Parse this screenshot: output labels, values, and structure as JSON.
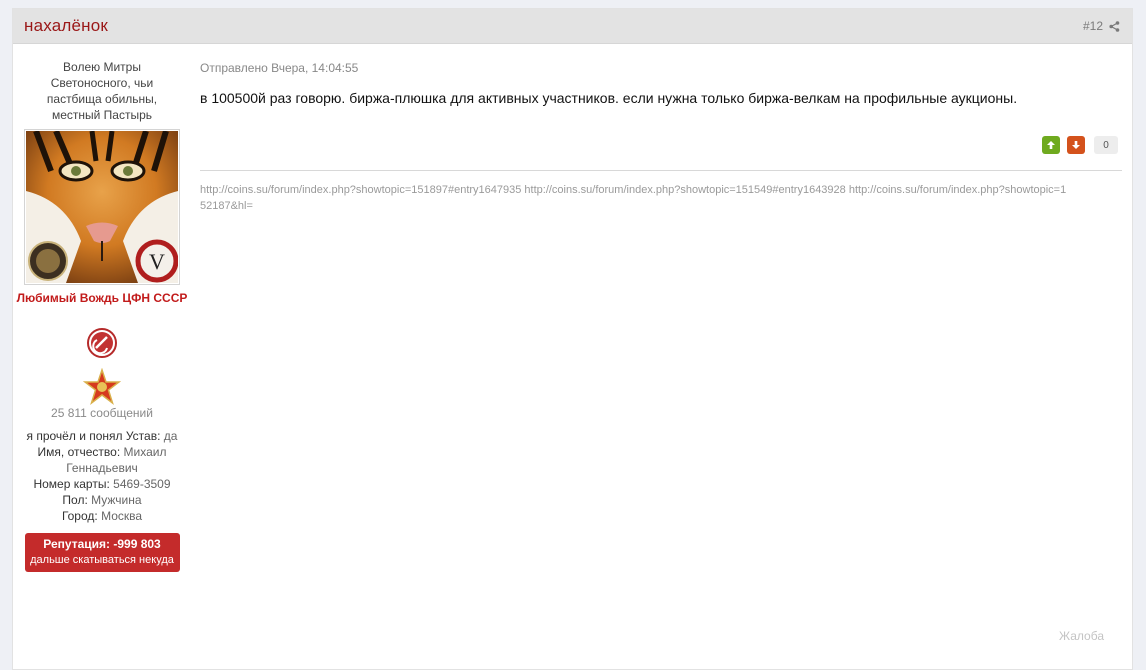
{
  "post": {
    "author": "нахалёнок",
    "number": "#12",
    "posted_label": "Отправлено Вчера, 14:04:55",
    "text": "в 100500й раз говорю. биржа-плюшка для активных участников. если нужна только биржа-велкам на профильные аукционы.",
    "rating": {
      "up_icon": "arrow-up-icon",
      "down_icon": "arrow-down-icon",
      "count": "0"
    },
    "signature": "http://coins.su/forum/index.php?showtopic=151897#entry1647935 http://coins.su/forum/index.php?showtopic=151549#entry1643928 http://coins.su/forum/index.php?showtopic=152187&hl=",
    "report_label": "Жалоба"
  },
  "author_panel": {
    "title": "Волею Митры Светоносного, чьи пастбища обильны, местный Пастырь",
    "group": "Любимый Вождь ЦФН СССР",
    "post_count": "25 811 сообщений",
    "fields": [
      {
        "label": "я прочёл и понял Устав:",
        "value": "да"
      },
      {
        "label": "Имя, отчество:",
        "value": "Михаил Геннадьевич"
      },
      {
        "label": "Номер карты:",
        "value": "5469-3509"
      },
      {
        "label": "Пол:",
        "value": "Мужчина"
      },
      {
        "label": "Город:",
        "value": "Москва"
      }
    ],
    "reputation_title": "Репутация: -999 803",
    "reputation_sub": "дальше скатываться некуда"
  },
  "colors": {
    "author": "#9a1717",
    "group": "#c21b1b",
    "reputation_bg": "#c42b2b",
    "rate_up": "#6faa1f",
    "rate_down": "#d4521c"
  }
}
